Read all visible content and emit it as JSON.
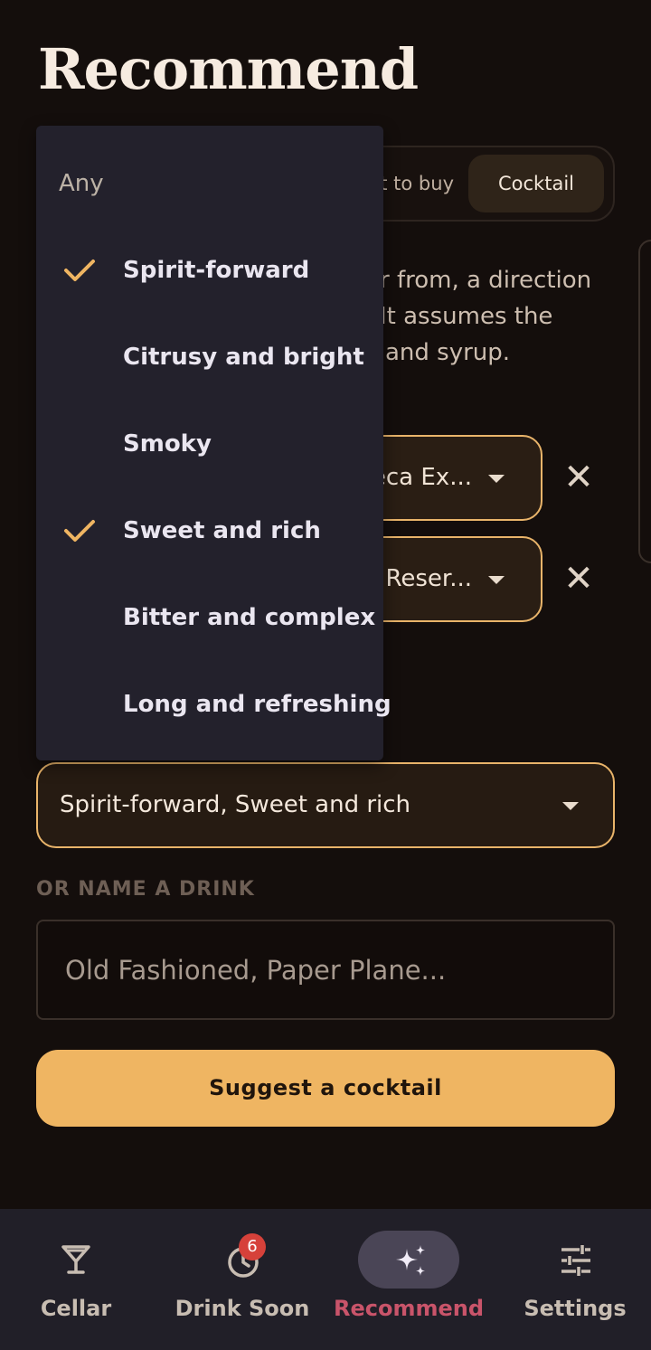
{
  "page": {
    "title": "Recommend"
  },
  "mode_toggle": {
    "options_visible": [
      "t to buy",
      "Cocktail"
    ],
    "selected": "Cocktail"
  },
  "description": {
    "lines": [
      "r from, a direction",
      "It assumes the",
      "and syrup."
    ]
  },
  "bottles": [
    {
      "value": "eca Ex...",
      "remove_symbol": "✕"
    },
    {
      "value": "Reser...",
      "remove_symbol": "✕"
    }
  ],
  "flavor": {
    "selected_value": "Spirit-forward, Sweet and rich",
    "menu": [
      {
        "label": "Any",
        "checked": false
      },
      {
        "label": "Spirit-forward",
        "checked": true
      },
      {
        "label": "Citrusy and bright",
        "checked": false
      },
      {
        "label": "Smoky",
        "checked": false
      },
      {
        "label": "Sweet and rich",
        "checked": true
      },
      {
        "label": "Bitter and complex",
        "checked": false
      },
      {
        "label": "Long and refreshing",
        "checked": false
      }
    ]
  },
  "name_drink": {
    "label": "OR NAME A DRINK",
    "placeholder": "Old Fashioned, Paper Plane..."
  },
  "suggest_button": {
    "label": "Suggest a cocktail"
  },
  "nav": {
    "items": [
      {
        "label": "Cellar",
        "icon": "cocktail-glass-icon",
        "active": false
      },
      {
        "label": "Drink Soon",
        "icon": "clock-icon",
        "active": false,
        "badge": "6"
      },
      {
        "label": "Recommend",
        "icon": "sparkles-icon",
        "active": true
      },
      {
        "label": "Settings",
        "icon": "sliders-icon",
        "active": false
      }
    ]
  },
  "colors": {
    "background": "#140e0c",
    "accent": "#efb562",
    "menu_bg": "#23212c",
    "nav_active": "#c9546a",
    "badge": "#d6413a"
  }
}
